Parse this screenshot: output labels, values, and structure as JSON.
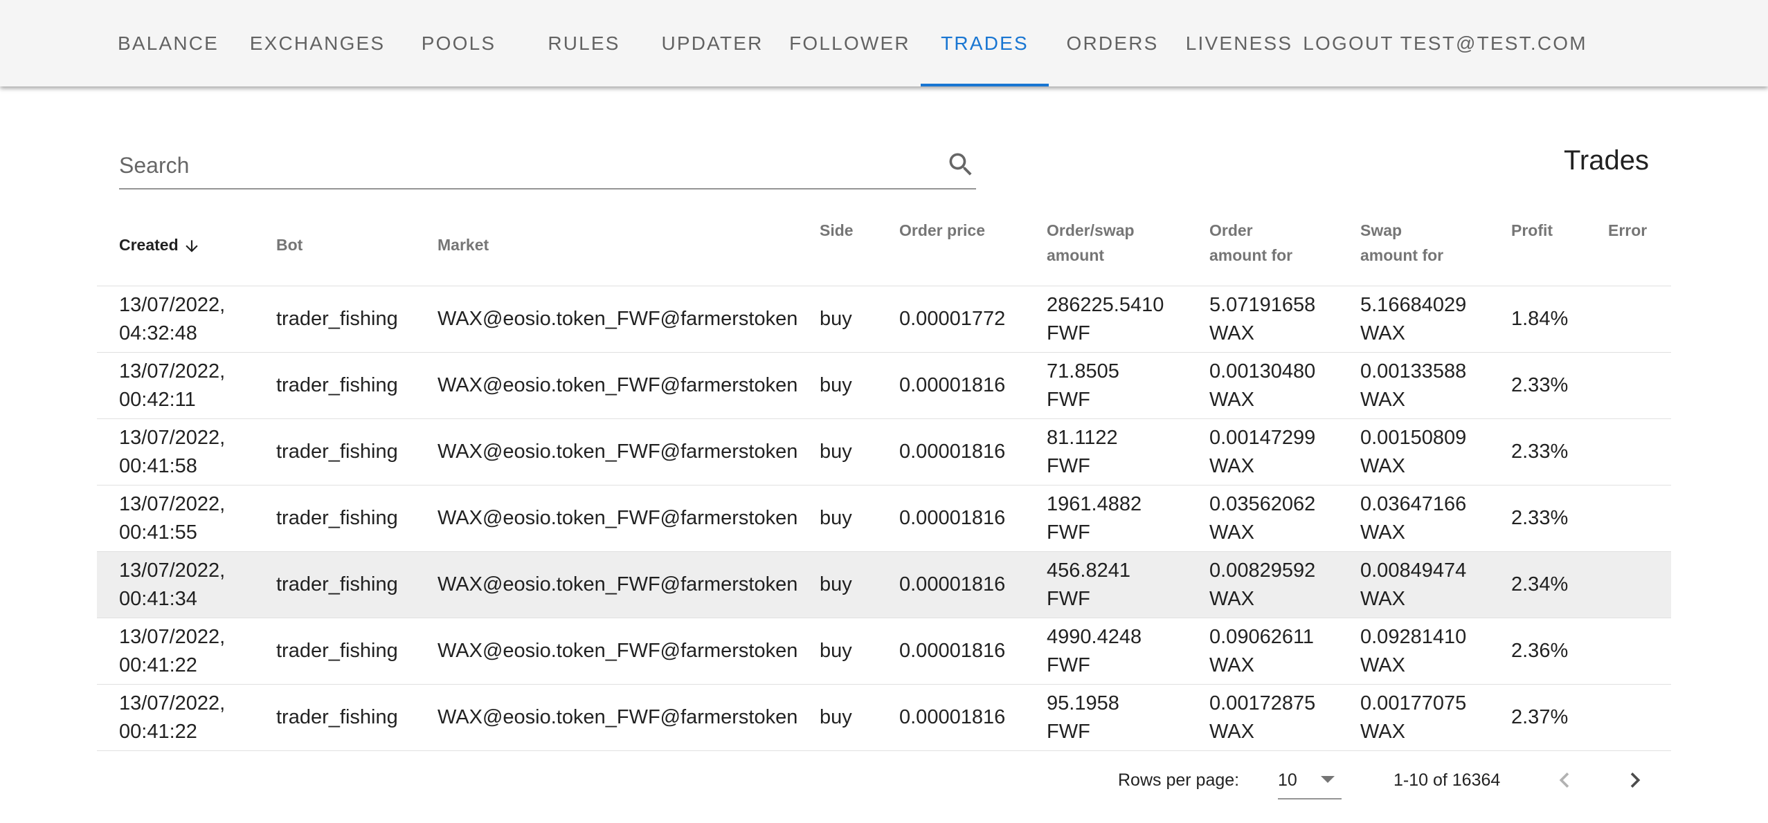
{
  "nav": {
    "tabs": [
      {
        "label": "BALANCE"
      },
      {
        "label": "EXCHANGES"
      },
      {
        "label": "POOLS"
      },
      {
        "label": "RULES"
      },
      {
        "label": "UPDATER"
      },
      {
        "label": "FOLLOWER"
      },
      {
        "label": "TRADES",
        "active": true
      },
      {
        "label": "ORDERS"
      },
      {
        "label": "LIVENESS"
      },
      {
        "label": "LOGOUT TEST@TEST.COM"
      }
    ],
    "accent_color": "#1976d2"
  },
  "search": {
    "placeholder": "Search",
    "value": "",
    "icon": "search-icon"
  },
  "page_title": "Trades",
  "table": {
    "columns": {
      "created": "Created",
      "bot": "Bot",
      "market": "Market",
      "side": "Side",
      "order_price": "Order price",
      "order_swap_amount": "Order/swap amount",
      "order_amount_for": "Order amount for",
      "swap_amount_for": "Swap amount for",
      "profit": "Profit",
      "error": "Error"
    },
    "sort": {
      "column": "Created",
      "direction": "descending",
      "icon": "arrow-down-icon"
    },
    "highlight_row": 4,
    "rows": [
      {
        "created_date": "13/07/2022,",
        "created_time": "04:32:48",
        "bot": "trader_fishing",
        "market": "WAX@eosio.token_FWF@farmerstoken",
        "side": "buy",
        "order_price": "0.00001772",
        "order_swap_amount": "286225.5410 FWF",
        "order_amount_for": "5.07191658 WAX",
        "swap_amount_for": "5.16684029 WAX",
        "profit": "1.84%",
        "error": ""
      },
      {
        "created_date": "13/07/2022,",
        "created_time": "00:42:11",
        "bot": "trader_fishing",
        "market": "WAX@eosio.token_FWF@farmerstoken",
        "side": "buy",
        "order_price": "0.00001816",
        "order_swap_amount": "71.8505 FWF",
        "order_amount_for": "0.00130480 WAX",
        "swap_amount_for": "0.00133588 WAX",
        "profit": "2.33%",
        "error": ""
      },
      {
        "created_date": "13/07/2022,",
        "created_time": "00:41:58",
        "bot": "trader_fishing",
        "market": "WAX@eosio.token_FWF@farmerstoken",
        "side": "buy",
        "order_price": "0.00001816",
        "order_swap_amount": "81.1122 FWF",
        "order_amount_for": "0.00147299 WAX",
        "swap_amount_for": "0.00150809 WAX",
        "profit": "2.33%",
        "error": ""
      },
      {
        "created_date": "13/07/2022,",
        "created_time": "00:41:55",
        "bot": "trader_fishing",
        "market": "WAX@eosio.token_FWF@farmerstoken",
        "side": "buy",
        "order_price": "0.00001816",
        "order_swap_amount": "1961.4882 FWF",
        "order_amount_for": "0.03562062 WAX",
        "swap_amount_for": "0.03647166 WAX",
        "profit": "2.33%",
        "error": ""
      },
      {
        "created_date": "13/07/2022,",
        "created_time": "00:41:34",
        "bot": "trader_fishing",
        "market": "WAX@eosio.token_FWF@farmerstoken",
        "side": "buy",
        "order_price": "0.00001816",
        "order_swap_amount": "456.8241 FWF",
        "order_amount_for": "0.00829592 WAX",
        "swap_amount_for": "0.00849474 WAX",
        "profit": "2.34%",
        "error": ""
      },
      {
        "created_date": "13/07/2022,",
        "created_time": "00:41:22",
        "bot": "trader_fishing",
        "market": "WAX@eosio.token_FWF@farmerstoken",
        "side": "buy",
        "order_price": "0.00001816",
        "order_swap_amount": "4990.4248 FWF",
        "order_amount_for": "0.09062611 WAX",
        "swap_amount_for": "0.09281410 WAX",
        "profit": "2.36%",
        "error": ""
      },
      {
        "created_date": "13/07/2022,",
        "created_time": "00:41:22",
        "bot": "trader_fishing",
        "market": "WAX@eosio.token_FWF@farmerstoken",
        "side": "buy",
        "order_price": "0.00001816",
        "order_swap_amount": "95.1958 FWF",
        "order_amount_for": "0.00172875 WAX",
        "swap_amount_for": "0.00177075 WAX",
        "profit": "2.37%",
        "error": ""
      }
    ]
  },
  "pagination": {
    "rows_per_page_label": "Rows per page:",
    "rows_per_page_value": "10",
    "range_label": "1-10 of 16364",
    "prev_icon": "chevron-left-icon",
    "next_icon": "chevron-right-icon"
  }
}
